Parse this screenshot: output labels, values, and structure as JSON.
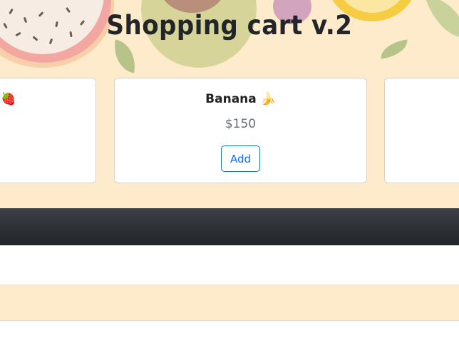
{
  "header": {
    "title": "Shopping cart v.2"
  },
  "products": [
    {
      "name": "",
      "emoji": "🍓",
      "price": ""
    },
    {
      "name": "Banana",
      "emoji": "🍌",
      "price": "$150",
      "add_label": "Add"
    },
    {
      "name": "",
      "emoji": "",
      "price": ""
    }
  ],
  "colors": {
    "page_background": "#fdebcc",
    "primary": "#0d6efd",
    "dark_bar": "#212529"
  }
}
